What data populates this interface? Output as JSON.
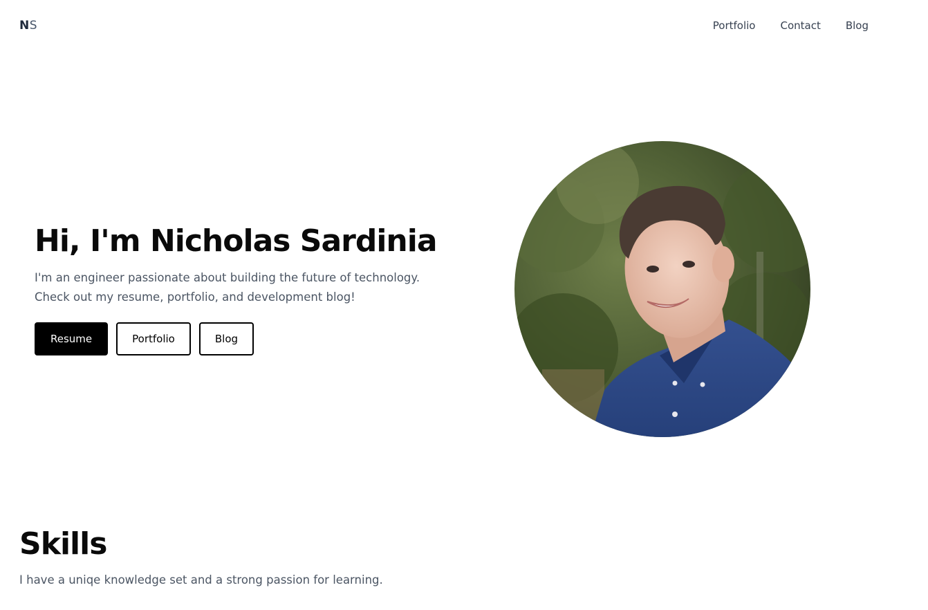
{
  "nav": {
    "logo_part1": "N",
    "logo_part2": "S",
    "links": [
      "Portfolio",
      "Contact",
      "Blog"
    ]
  },
  "hero": {
    "title": "Hi, I'm Nicholas Sardinia",
    "subtitle_line1": "I'm an engineer passionate about building the future of technology.",
    "subtitle_line2": "Check out my resume, portfolio, and development blog!",
    "buttons": [
      "Resume",
      "Portfolio",
      "Blog"
    ]
  },
  "skills": {
    "title": "Skills",
    "subtitle": "I have a uniqe knowledge set and a strong passion for learning."
  },
  "colors": {
    "primary_button_bg": "#000000",
    "text_dark": "#0a0a0a",
    "text_muted": "#4b5563",
    "shirt_blue": "#2f4b8c"
  }
}
